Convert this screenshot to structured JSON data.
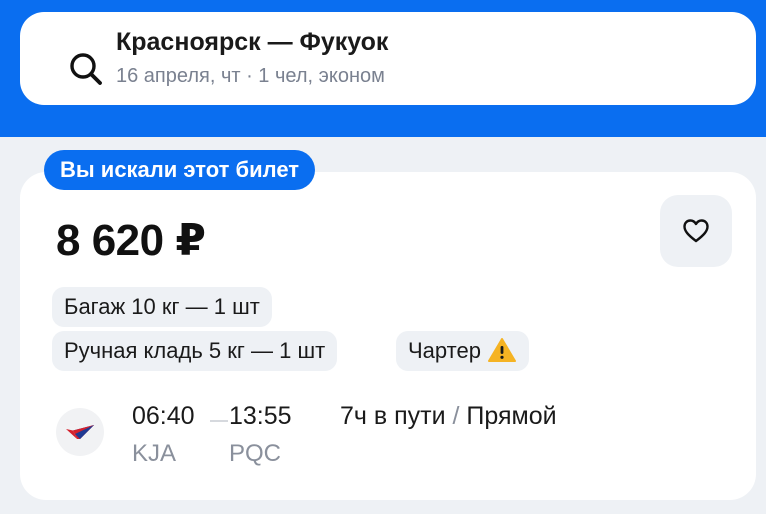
{
  "search": {
    "route": "Красноярск — Фукуок",
    "details": "16 апреля, чт · 1 чел, эконом"
  },
  "ticket": {
    "badge": "Вы искали этот билет",
    "price": "8 620 ₽",
    "chips": {
      "baggage": "Багаж 10 кг — 1 шт",
      "hand_luggage": "Ручная кладь 5 кг — 1 шт",
      "charter": "Чартер"
    },
    "flight": {
      "departure_time": "06:40",
      "arrival_time": "13:55",
      "departure_code": "KJA",
      "arrival_code": "PQC",
      "duration": "7ч в пути",
      "separator": "/",
      "type": "Прямой"
    }
  },
  "colors": {
    "brand_blue": "#0a6ef0",
    "warning": "#f5b323",
    "airline_red": "#d4202c",
    "airline_navy": "#1f3a93"
  },
  "icons": {
    "search": "search-icon",
    "favorite": "heart-icon",
    "warning": "warning-icon",
    "airline": "airline-logo-icon"
  }
}
